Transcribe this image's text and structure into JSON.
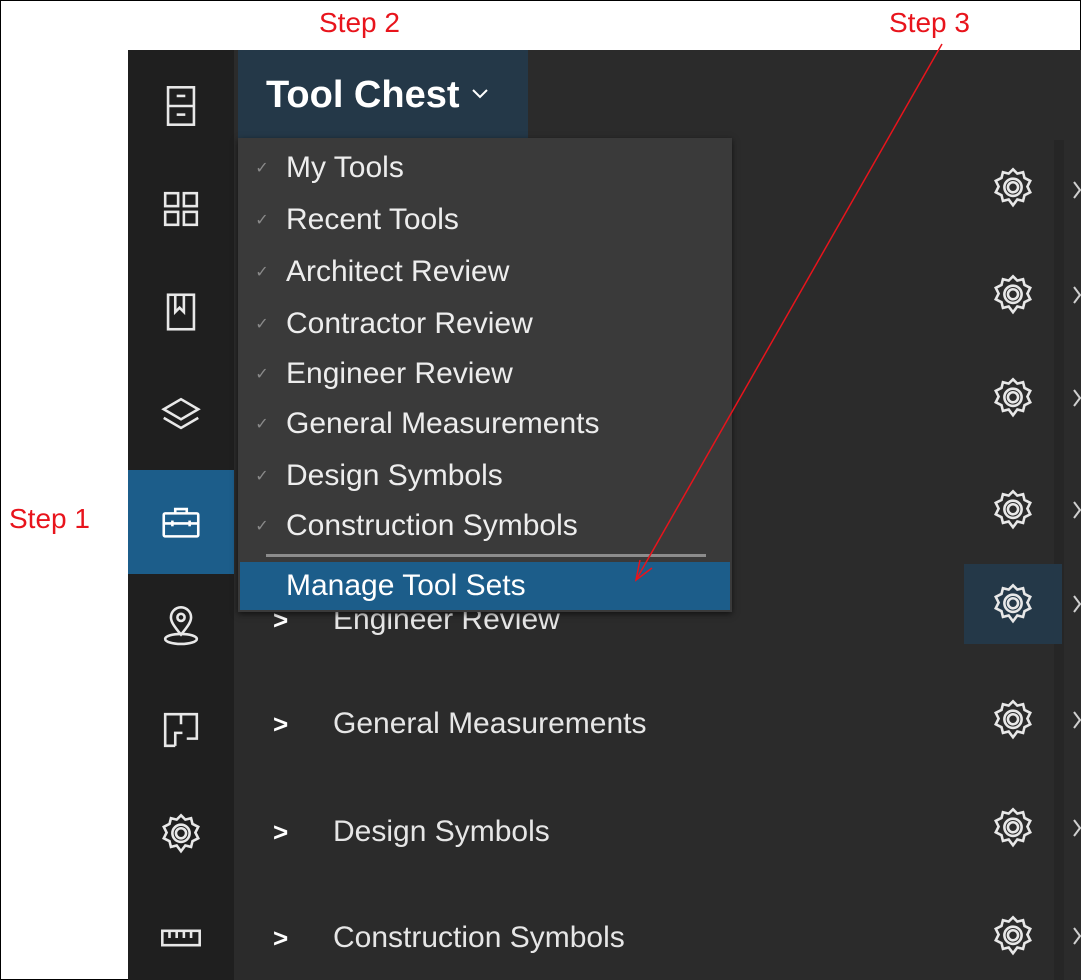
{
  "annotations": {
    "step1": "Step 1",
    "step2": "Step 2",
    "step3": "Step 3"
  },
  "panel": {
    "title": "Tool Chest"
  },
  "dropdown": {
    "items": [
      {
        "label": "My Tools"
      },
      {
        "label": "Recent Tools"
      },
      {
        "label": "Architect Review"
      },
      {
        "label": "Contractor Review"
      },
      {
        "label": "Engineer Review"
      },
      {
        "label": "General Measurements"
      },
      {
        "label": "Design Symbols"
      },
      {
        "label": "Construction Symbols"
      }
    ],
    "manage_label": "Manage Tool Sets"
  },
  "toolsets": {
    "items": [
      {
        "label": "Engineer Review"
      },
      {
        "label": "General Measurements"
      },
      {
        "label": "Design Symbols"
      },
      {
        "label": "Construction Symbols"
      }
    ]
  },
  "rail": {
    "icons": [
      "file-cabinet-icon",
      "grid-icon",
      "bookmark-icon",
      "layers-icon",
      "toolbox-icon",
      "location-pin-icon",
      "floorplan-icon",
      "gear-icon",
      "ruler-icon"
    ],
    "active_index": 4
  },
  "colors": {
    "accent": "#1c5d8a",
    "annotation": "#e8141c",
    "header_bg": "#243848"
  }
}
